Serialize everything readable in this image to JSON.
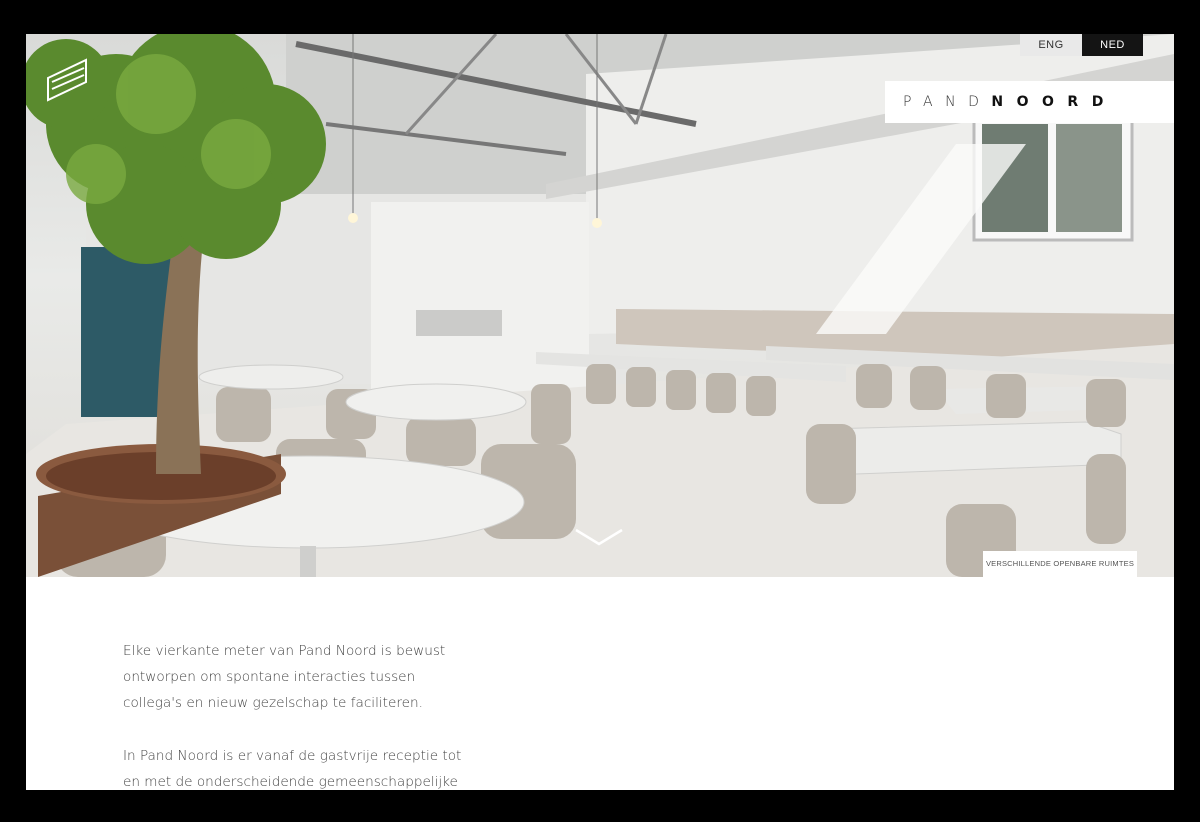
{
  "language_switch": {
    "eng": "ENG",
    "ned": "NED"
  },
  "logo": {
    "light": "PAND",
    "bold": "NOORD"
  },
  "hero": {
    "caption": "VERSCHILLENDE OPENBARE RUIMTES"
  },
  "content": {
    "paragraph_1": "Elke vierkante meter van Pand Noord is bewust ontworpen om spontane interacties tussen collega's en nieuw gezelschap te faciliteren.",
    "paragraph_2": "In Pand Noord is er vanaf de gastvrije receptie tot en met de onderscheidende gemeenschappelijke"
  },
  "icons": {
    "menu": "menu-icon",
    "scroll": "chevron-down-icon"
  }
}
